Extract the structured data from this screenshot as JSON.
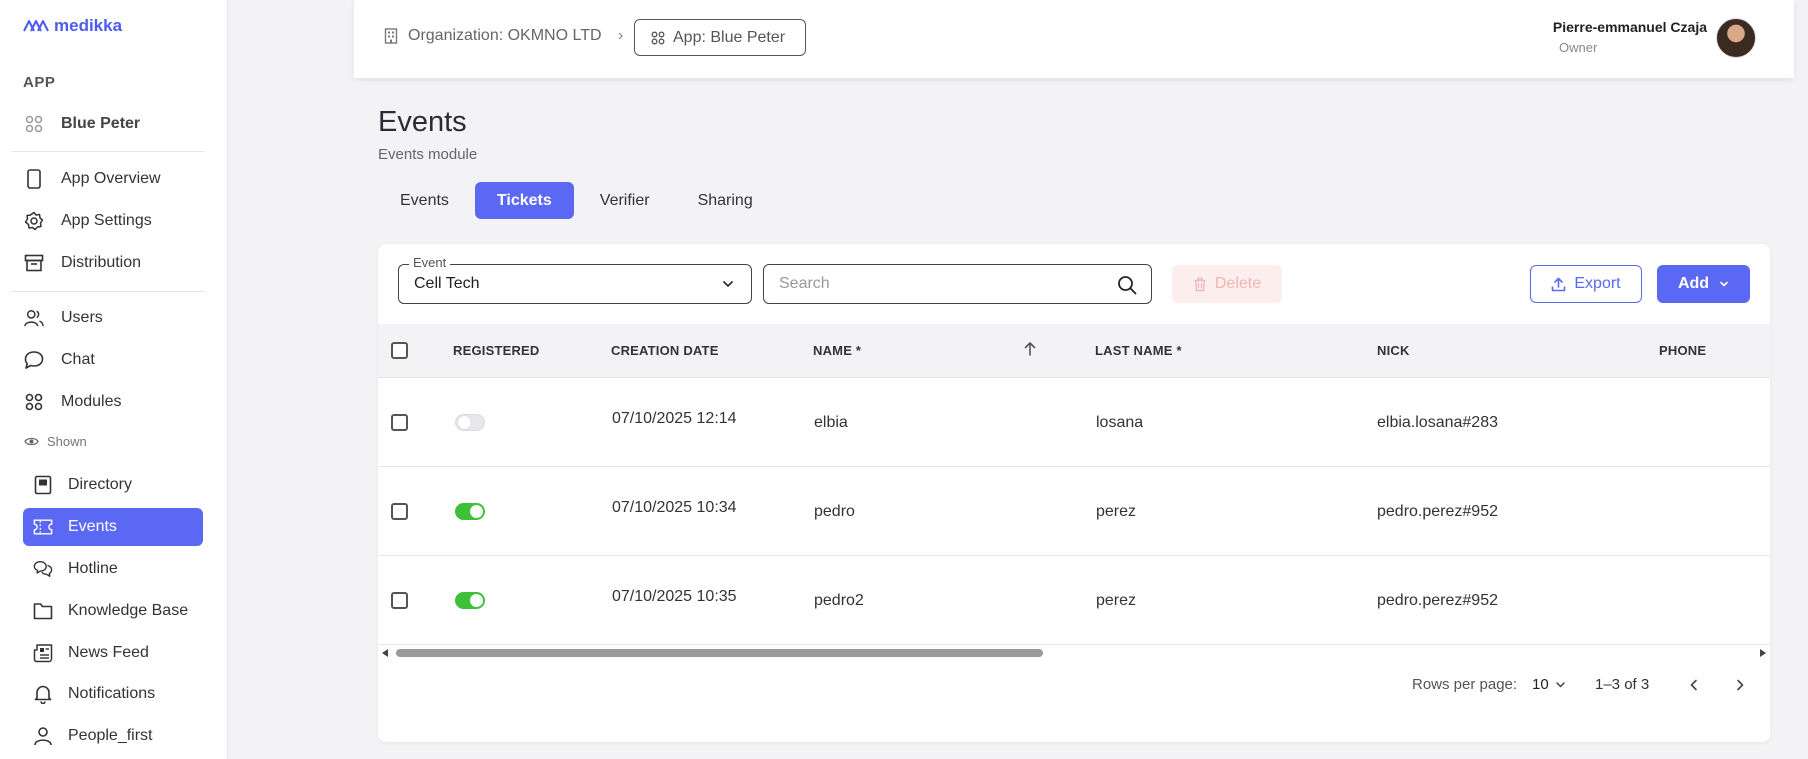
{
  "brand": {
    "name": "medikka"
  },
  "sidebar": {
    "section_title": "APP",
    "app_item": "Blue Peter",
    "items": [
      {
        "label": "App Overview"
      },
      {
        "label": "App Settings"
      },
      {
        "label": "Distribution"
      },
      {
        "label": "Users"
      },
      {
        "label": "Chat"
      },
      {
        "label": "Modules"
      }
    ],
    "shown_label": "Shown",
    "modules": [
      {
        "label": "Directory"
      },
      {
        "label": "Events"
      },
      {
        "label": "Hotline"
      },
      {
        "label": "Knowledge Base"
      },
      {
        "label": "News Feed"
      },
      {
        "label": "Notifications"
      },
      {
        "label": "People_first"
      }
    ]
  },
  "header": {
    "org_crumb": "Organization: OKMNO LTD",
    "separator": "›",
    "app_crumb": "App: Blue Peter",
    "user_name": "Pierre-emmanuel Czaja",
    "user_role": "Owner"
  },
  "page": {
    "title": "Events",
    "subtitle": "Events module"
  },
  "tabs": [
    "Events",
    "Tickets",
    "Verifier",
    "Sharing"
  ],
  "active_tab": "Tickets",
  "toolbar": {
    "event_legend": "Event",
    "event_value": "Cell Tech",
    "search_placeholder": "Search",
    "delete_label": "Delete",
    "export_label": "Export",
    "add_label": "Add"
  },
  "table": {
    "headers": {
      "registered": "REGISTERED",
      "creation_date": "CREATION DATE",
      "name": "NAME *",
      "last_name": "LAST NAME *",
      "nick": "NICK",
      "phone": "PHONE"
    },
    "rows": [
      {
        "registered": false,
        "creation_date": "07/10/2025 12:14",
        "name": "elbia",
        "last_name": "losana",
        "nick": "elbia.losana#283"
      },
      {
        "registered": true,
        "creation_date": "07/10/2025 10:34",
        "name": "pedro",
        "last_name": "perez",
        "nick": "pedro.perez#952"
      },
      {
        "registered": true,
        "creation_date": "07/10/2025 10:35",
        "name": "pedro2",
        "last_name": "perez",
        "nick": "pedro.perez#952"
      }
    ]
  },
  "pagination": {
    "rows_per_page_label": "Rows per page:",
    "rows_per_page": "10",
    "range": "1–3 of 3"
  },
  "colors": {
    "accent": "#5b68f4",
    "toggle_on": "#3fc03a",
    "delete_bg": "#fdeeee"
  }
}
